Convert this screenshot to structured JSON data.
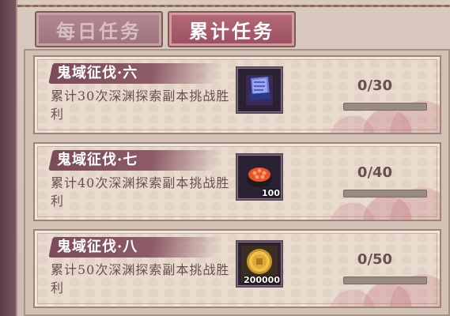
{
  "tabs": {
    "daily_label": "每日任务",
    "cumulative_label": "累计任务"
  },
  "tasks": [
    {
      "title": "鬼域征伐·六",
      "description": "累计30次深渊探索副本挑战胜利",
      "reward_icon": "scroll-icon",
      "reward_count": "",
      "progress_text": "0/30",
      "progress_fraction": 0
    },
    {
      "title": "鬼域征伐·七",
      "description": "累计40次深渊探索副本挑战胜利",
      "reward_icon": "sushi-icon",
      "reward_count": "100",
      "progress_text": "0/40",
      "progress_fraction": 0
    },
    {
      "title": "鬼域征伐·八",
      "description": "累计50次深渊探索副本挑战胜利",
      "reward_icon": "gold-coin-icon",
      "reward_count": "200000",
      "progress_text": "0/50",
      "progress_fraction": 0
    }
  ],
  "colors": {
    "accent": "#9a5060",
    "title_brush": "#7a4b58",
    "text": "#6b4f4e"
  }
}
